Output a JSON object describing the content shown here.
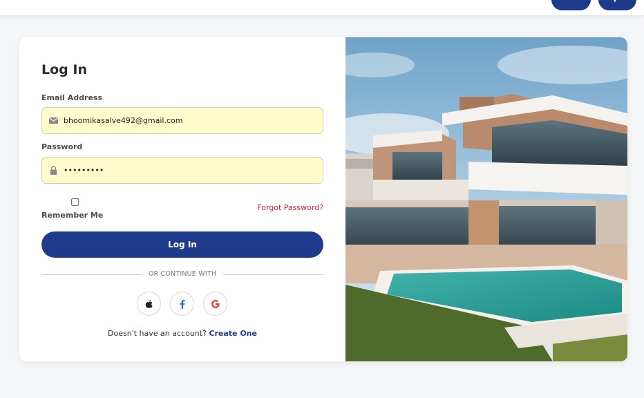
{
  "nav": {
    "button_a": "",
    "button_b": "Up"
  },
  "login": {
    "title": "Log In",
    "email_label": "Email Address",
    "email_value": "bhoomikasalve492@gmail.com",
    "password_label": "Password",
    "password_value": "•••••••••",
    "remember_label": "Remember Me",
    "forgot_link": "Forgot Password?",
    "submit_label": "Log In",
    "divider_text": "OR CONTINUE WITH",
    "social": [
      "apple-icon",
      "facebook-icon",
      "google-icon"
    ],
    "signup_prompt": "Doesn't have an account?",
    "signup_link": "Create One"
  },
  "colors": {
    "primary": "#1e3a8a",
    "autofill": "#fffbcc",
    "danger": "#d9252a"
  }
}
